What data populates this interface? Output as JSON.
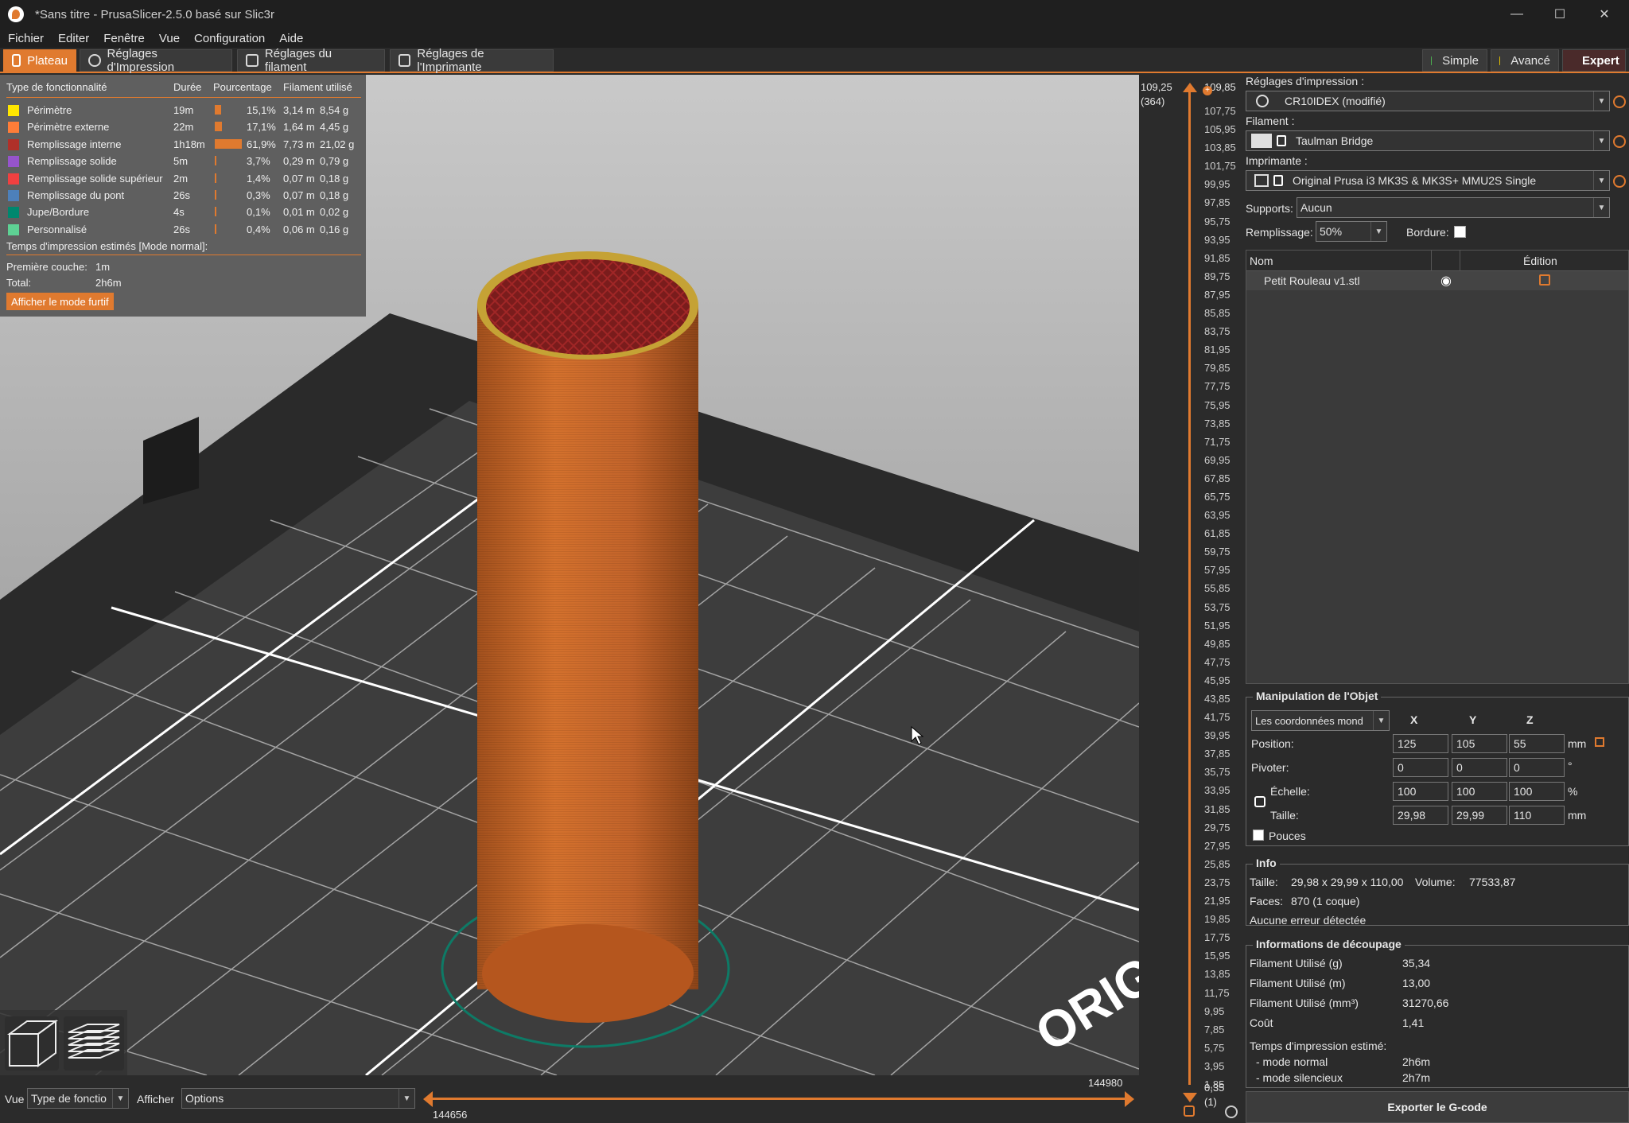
{
  "window": {
    "title": "*Sans titre - PrusaSlicer-2.5.0 basé sur Slic3r",
    "controls": {
      "minimize": "—",
      "maximize": "☐",
      "close": "✕"
    }
  },
  "menu": [
    "Fichier",
    "Editer",
    "Fenêtre",
    "Vue",
    "Configuration",
    "Aide"
  ],
  "tabs": [
    {
      "label": "Plateau",
      "icon": "plate-icon",
      "active": true
    },
    {
      "label": "Réglages d'Impression",
      "icon": "gear-icon"
    },
    {
      "label": "Réglages du filament",
      "icon": "spool-icon"
    },
    {
      "label": "Réglages de l'Imprimante",
      "icon": "printer-icon"
    }
  ],
  "modes": [
    {
      "label": "Simple",
      "color": "#4caf50"
    },
    {
      "label": "Avancé",
      "color": "#e5c100"
    },
    {
      "label": "Expert",
      "color": "#d32f2f",
      "active": true
    }
  ],
  "legend": {
    "headers": [
      "Type de fonctionnalité",
      "Durée",
      "Pourcentage",
      "Filament utilisé"
    ],
    "rows": [
      {
        "name": "Périmètre",
        "color": "#ffe600",
        "time": "19m",
        "pct": "15,1%",
        "pct_value": 15.1,
        "length": "3,14 m",
        "weight": "8,54 g"
      },
      {
        "name": "Périmètre externe",
        "color": "#ff7d38",
        "time": "22m",
        "pct": "17,1%",
        "pct_value": 17.1,
        "length": "1,64 m",
        "weight": "4,45 g"
      },
      {
        "name": "Remplissage interne",
        "color": "#b03029",
        "time": "1h18m",
        "pct": "61,9%",
        "pct_value": 61.9,
        "length": "7,73 m",
        "weight": "21,02 g"
      },
      {
        "name": "Remplissage solide",
        "color": "#9654cc",
        "time": "5m",
        "pct": "3,7%",
        "pct_value": 3.7,
        "length": "0,29 m",
        "weight": "0,79 g"
      },
      {
        "name": "Remplissage solide supérieur",
        "color": "#f04040",
        "time": "2m",
        "pct": "1,4%",
        "pct_value": 1.4,
        "length": "0,07 m",
        "weight": "0,18 g"
      },
      {
        "name": "Remplissage du pont",
        "color": "#4d80ba",
        "time": "26s",
        "pct": "0,3%",
        "pct_value": 0.3,
        "length": "0,07 m",
        "weight": "0,18 g"
      },
      {
        "name": "Jupe/Bordure",
        "color": "#00876e",
        "time": "4s",
        "pct": "0,1%",
        "pct_value": 0.1,
        "length": "0,01 m",
        "weight": "0,02 g"
      },
      {
        "name": "Personnalisé",
        "color": "#5ed194",
        "time": "26s",
        "pct": "0,4%",
        "pct_value": 0.4,
        "length": "0,06 m",
        "weight": "0,16 g"
      }
    ],
    "estimate_title": "Temps d'impression estimés [Mode normal]:",
    "first_layer_label": "Première couche:",
    "first_layer_value": "1m",
    "total_label": "Total:",
    "total_value": "2h6m",
    "stealth_button": "Afficher le mode furtif"
  },
  "viewport": {
    "bed_text": "ORIGI"
  },
  "bottombar": {
    "view_label": "Vue",
    "view_value": "Type de fonctio",
    "show_label": "Afficher",
    "show_value": "Options",
    "slider_max": "144980",
    "slider_min": "144656"
  },
  "layer_slider": {
    "top_value": "109,25",
    "top_layer": "(364)",
    "top_height": "109,85",
    "bottom_value": "0,35",
    "bottom_layer": "(1)",
    "ticks": [
      "107,75",
      "105,95",
      "103,85",
      "101,75",
      "99,95",
      "97,85",
      "95,75",
      "93,95",
      "91,85",
      "89,75",
      "87,95",
      "85,85",
      "83,75",
      "81,95",
      "79,85",
      "77,75",
      "75,95",
      "73,85",
      "71,75",
      "69,95",
      "67,85",
      "65,75",
      "63,95",
      "61,85",
      "59,75",
      "57,95",
      "55,85",
      "53,75",
      "51,95",
      "49,85",
      "47,75",
      "45,95",
      "43,85",
      "41,75",
      "39,95",
      "37,85",
      "35,75",
      "33,95",
      "31,85",
      "29,75",
      "27,95",
      "25,85",
      "23,75",
      "21,95",
      "19,85",
      "17,75",
      "15,95",
      "13,85",
      "11,75",
      "9,95",
      "7,85",
      "5,75",
      "3,95",
      "1,85"
    ]
  },
  "panel": {
    "print_settings_label": "Réglages d'impression :",
    "print_settings_value": "CR10IDEX (modifié)",
    "filament_label": "Filament :",
    "filament_value": "Taulman Bridge",
    "printer_label": "Imprimante :",
    "printer_value": "Original Prusa i3 MK3S & MK3S+ MMU2S Single",
    "supports_label": "Supports:",
    "supports_value": "Aucun",
    "infill_label": "Remplissage:",
    "infill_value": "50%",
    "brim_label": "Bordure:",
    "objects_header_name": "Nom",
    "objects_header_edit": "Édition",
    "objects": [
      {
        "name": "Petit Rouleau v1.stl"
      }
    ],
    "manipulation": {
      "title": "Manipulation de l'Objet",
      "coords_value": "Les coordonnées mond",
      "axes": [
        "X",
        "Y",
        "Z"
      ],
      "position_label": "Position:",
      "position": [
        "125",
        "105",
        "55"
      ],
      "position_unit": "mm",
      "rotate_label": "Pivoter:",
      "rotate": [
        "0",
        "0",
        "0"
      ],
      "rotate_unit": "°",
      "scale_label": "Échelle:",
      "scale": [
        "100",
        "100",
        "100"
      ],
      "scale_unit": "%",
      "size_label": "Taille:",
      "size": [
        "29,98",
        "29,99",
        "110"
      ],
      "size_unit": "mm",
      "inches_label": "Pouces"
    },
    "info": {
      "title": "Info",
      "size_label": "Taille:",
      "size_value": "29,98 x 29,99 x 110,00",
      "volume_label": "Volume:",
      "volume_value": "77533,87",
      "faces_label": "Faces:",
      "faces_value": "870 (1 coque)",
      "errors": "Aucune erreur détectée"
    },
    "slicing": {
      "title": "Informations de découpage",
      "rows": [
        {
          "label": "Filament Utilisé (g)",
          "value": "35,34"
        },
        {
          "label": "Filament Utilisé (m)",
          "value": "13,00"
        },
        {
          "label": "Filament Utilisé (mm³)",
          "value": "31270,66"
        },
        {
          "label": "Coût",
          "value": "1,41"
        }
      ],
      "estimate_label": "Temps d'impression estimé:",
      "normal_label": "- mode normal",
      "normal_value": "2h6m",
      "silent_label": "- mode silencieux",
      "silent_value": "2h7m"
    },
    "export_button": "Exporter le G-code"
  }
}
